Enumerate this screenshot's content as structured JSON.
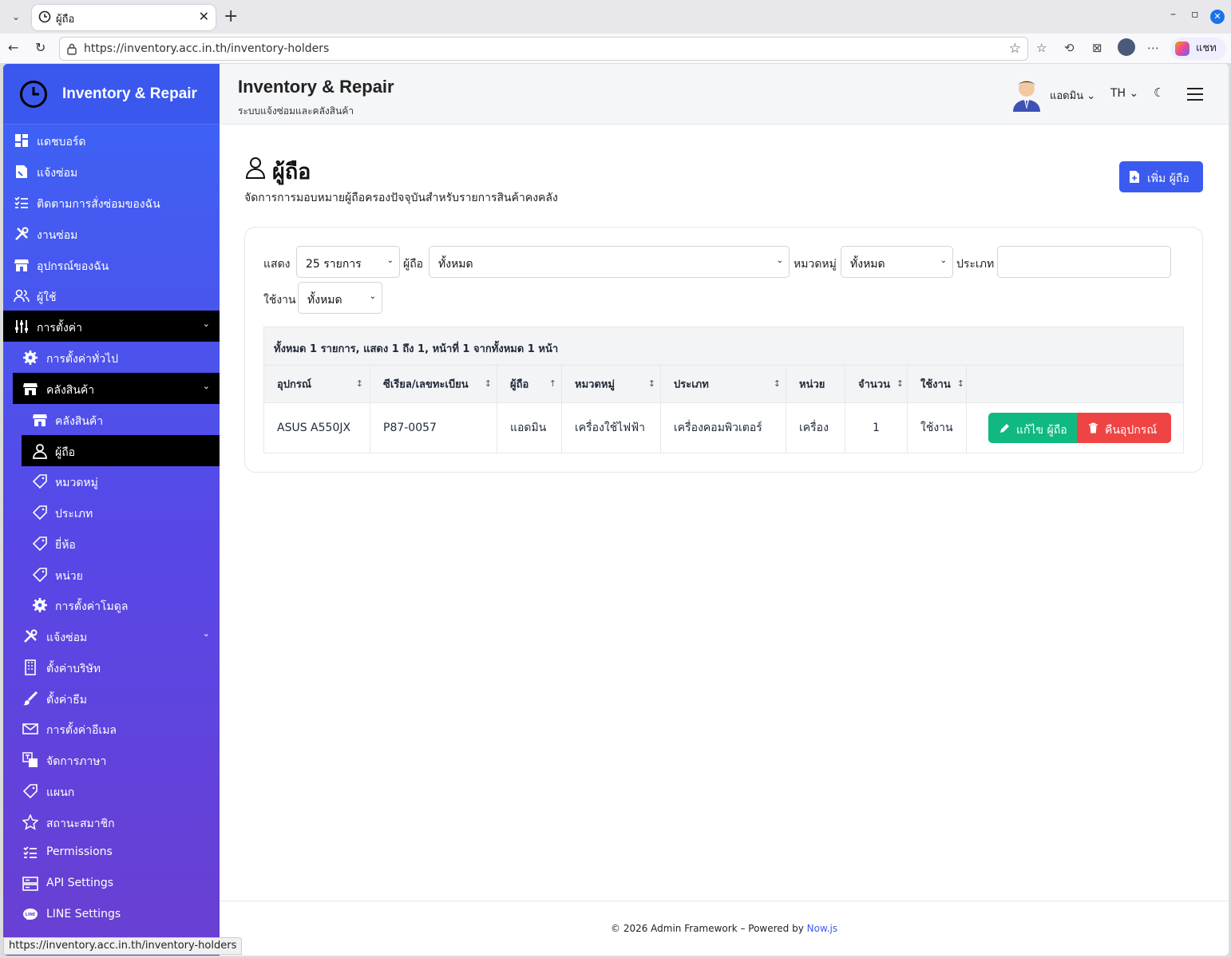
{
  "browser": {
    "tab_title": "ผู้ถือ",
    "url": "https://inventory.acc.in.th/inventory-holders",
    "chat_label": "แชท",
    "status_url": "https://inventory.acc.in.th/inventory-holders"
  },
  "sidebar": {
    "brand": "Inventory & Repair",
    "items": [
      {
        "label": "แดชบอร์ด",
        "icon": "dashboard-icon"
      },
      {
        "label": "แจ้งซ่อม",
        "icon": "repair-request-icon"
      },
      {
        "label": "ติดตามการสั่งซ่อมของฉัน",
        "icon": "checklist-icon"
      },
      {
        "label": "งานซ่อม",
        "icon": "tools-icon"
      },
      {
        "label": "อุปกรณ์ของฉัน",
        "icon": "store-icon"
      },
      {
        "label": "ผู้ใช้",
        "icon": "users-icon"
      },
      {
        "label": "การตั้งค่า",
        "icon": "sliders-icon"
      },
      {
        "label": "การตั้งค่าทั่วไป",
        "icon": "gear-icon"
      },
      {
        "label": "คลังสินค้า",
        "icon": "store-icon"
      },
      {
        "label": "คลังสินค้า",
        "icon": "store-icon"
      },
      {
        "label": "ผู้ถือ",
        "icon": "user-icon"
      },
      {
        "label": "หมวดหมู่",
        "icon": "tag-icon"
      },
      {
        "label": "ประเภท",
        "icon": "tag-icon"
      },
      {
        "label": "ยี่ห้อ",
        "icon": "tag-icon"
      },
      {
        "label": "หน่วย",
        "icon": "tag-icon"
      },
      {
        "label": "การตั้งค่าโมดูล",
        "icon": "gear-icon"
      },
      {
        "label": "แจ้งซ่อม",
        "icon": "tools-icon"
      },
      {
        "label": "ตั้งค่าบริษัท",
        "icon": "building-icon"
      },
      {
        "label": "ตั้งค่าธีม",
        "icon": "brush-icon"
      },
      {
        "label": "การตั้งค่าอีเมล",
        "icon": "envelope-icon"
      },
      {
        "label": "จัดการภาษา",
        "icon": "language-icon"
      },
      {
        "label": "แผนก",
        "icon": "tag-icon"
      },
      {
        "label": "สถานะสมาชิก",
        "icon": "star-icon"
      },
      {
        "label": "Permissions",
        "icon": "checklist-icon"
      },
      {
        "label": "API Settings",
        "icon": "server-icon"
      },
      {
        "label": "LINE Settings",
        "icon": "line-icon"
      }
    ]
  },
  "header": {
    "title": "Inventory & Repair",
    "subtitle": "ระบบแจ้งซ่อมและคลังสินค้า",
    "user": "แอดมิน",
    "lang": "TH"
  },
  "page": {
    "title": "ผู้ถือ",
    "description": "จัดการการมอบหมายผู้ถือครองปัจจุบันสำหรับรายการสินค้าคงคลัง",
    "add_button": "เพิ่ม ผู้ถือ"
  },
  "filters": {
    "show_label": "แสดง",
    "show_value": "25 รายการ",
    "holder_label": "ผู้ถือ",
    "holder_value": "ทั้งหมด",
    "category_label": "หมวดหมู่",
    "category_value": "ทั้งหมด",
    "type_label": "ประเภท",
    "type_value": "",
    "active_label": "ใช้งาน",
    "active_value": "ทั้งหมด"
  },
  "table": {
    "summary": "ทั้งหมด 1 รายการ, แสดง 1 ถึง 1, หน้าที่ 1 จากทั้งหมด 1 หน้า",
    "columns": [
      "อุปกรณ์",
      "ซีเรียล/เลขทะเบียน",
      "ผู้ถือ",
      "หมวดหมู่",
      "ประเภท",
      "หน่วย",
      "จำนวน",
      "ใช้งาน"
    ],
    "rows": [
      {
        "device": "ASUS A550JX",
        "serial": "P87-0057",
        "holder": "แอดมิน",
        "category": "เครื่องใช้ไฟฟ้า",
        "type": "เครื่องคอมพิวเตอร์",
        "unit": "เครื่อง",
        "qty": "1",
        "active": "ใช้งาน"
      }
    ],
    "edit_button": "แก้ไข ผู้ถือ",
    "return_button": "คืนอุปกรณ์"
  },
  "footer": {
    "text": "© 2026 Admin Framework – Powered by",
    "link": "Now.js"
  },
  "colors": {
    "primary": "#3b5bf0",
    "success": "#10b981",
    "danger": "#ef4444",
    "sidebar_top": "#3b64f6",
    "sidebar_bottom": "#6a3fd2"
  }
}
